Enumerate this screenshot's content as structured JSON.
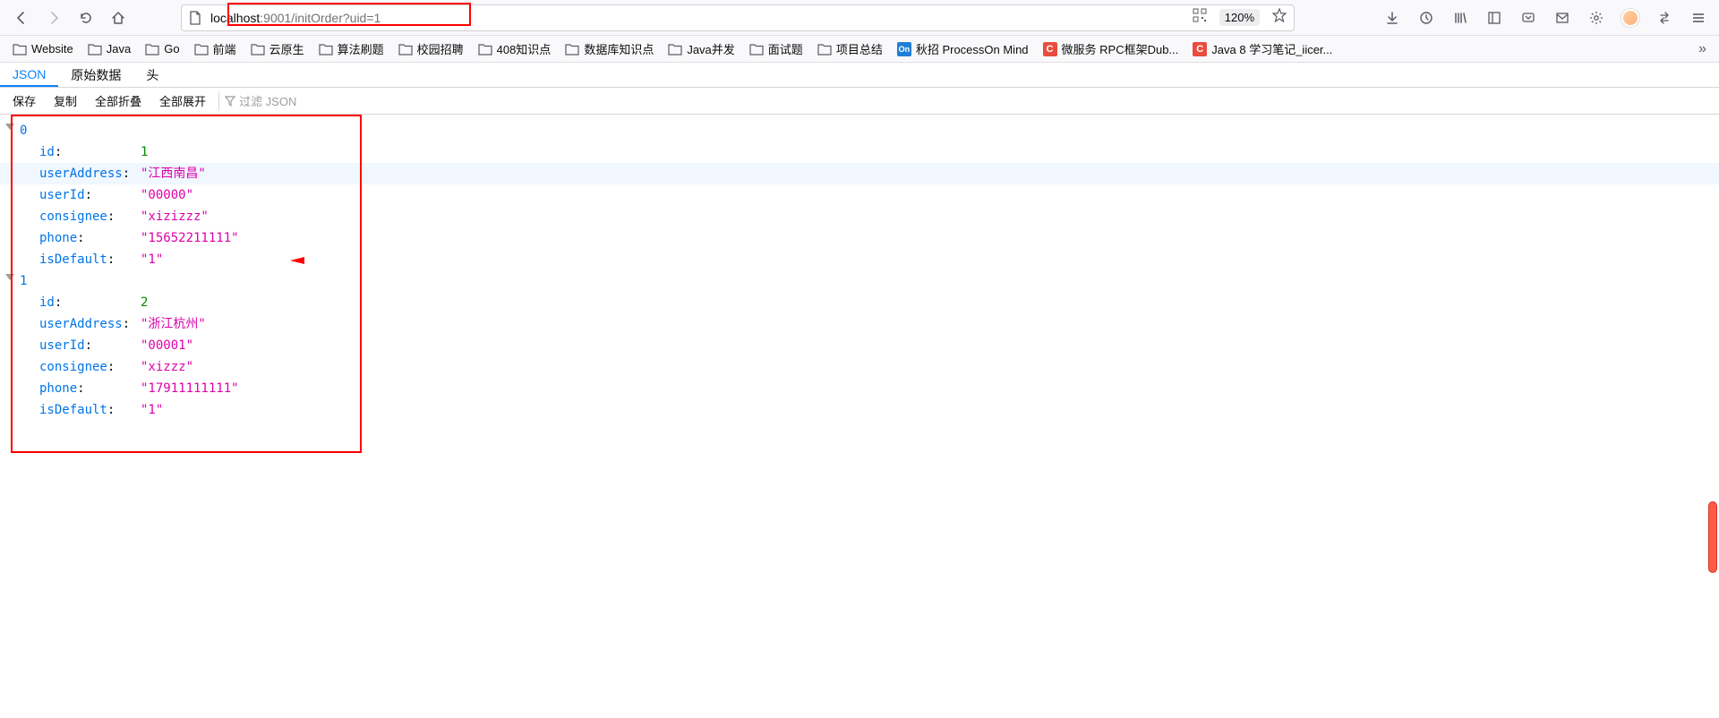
{
  "url": {
    "host": "localhost",
    "rest": ":9001/initOrder?uid=1"
  },
  "zoom": "120%",
  "bookmarks": [
    {
      "label": "Website",
      "type": "folder"
    },
    {
      "label": "Java",
      "type": "folder"
    },
    {
      "label": "Go",
      "type": "folder"
    },
    {
      "label": "前端",
      "type": "folder"
    },
    {
      "label": "云原生",
      "type": "folder"
    },
    {
      "label": "算法刷题",
      "type": "folder"
    },
    {
      "label": "校园招聘",
      "type": "folder"
    },
    {
      "label": "408知识点",
      "type": "folder"
    },
    {
      "label": "数据库知识点",
      "type": "folder"
    },
    {
      "label": "Java并发",
      "type": "folder"
    },
    {
      "label": "面试题",
      "type": "folder"
    },
    {
      "label": "项目总结",
      "type": "folder"
    },
    {
      "label": "秋招 ProcessOn Mind",
      "type": "on"
    },
    {
      "label": "微服务 RPC框架Dub...",
      "type": "c"
    },
    {
      "label": "Java 8 学习笔记_iicer...",
      "type": "c"
    }
  ],
  "viewTabs": [
    "JSON",
    "原始数据",
    "头"
  ],
  "actions": {
    "save": "保存",
    "copy": "复制",
    "collapseAll": "全部折叠",
    "expandAll": "全部展开",
    "filterPlaceholder": "过滤 JSON"
  },
  "json": [
    {
      "index": "0",
      "props": [
        {
          "key": "id",
          "value": "1",
          "type": "num"
        },
        {
          "key": "userAddress",
          "value": "\"江西南昌\"",
          "type": "str",
          "highlight": true
        },
        {
          "key": "userId",
          "value": "\"00000\"",
          "type": "str"
        },
        {
          "key": "consignee",
          "value": "\"xizizzz\"",
          "type": "str"
        },
        {
          "key": "phone",
          "value": "\"15652211111\"",
          "type": "str"
        },
        {
          "key": "isDefault",
          "value": "\"1\"",
          "type": "str"
        }
      ]
    },
    {
      "index": "1",
      "props": [
        {
          "key": "id",
          "value": "2",
          "type": "num"
        },
        {
          "key": "userAddress",
          "value": "\"浙江杭州\"",
          "type": "str"
        },
        {
          "key": "userId",
          "value": "\"00001\"",
          "type": "str"
        },
        {
          "key": "consignee",
          "value": "\"xizzz\"",
          "type": "str"
        },
        {
          "key": "phone",
          "value": "\"17911111111\"",
          "type": "str"
        },
        {
          "key": "isDefault",
          "value": "\"1\"",
          "type": "str"
        }
      ]
    }
  ]
}
